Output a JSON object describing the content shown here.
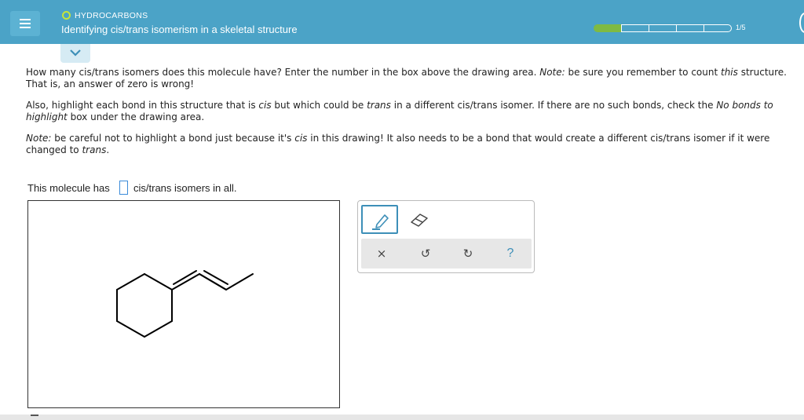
{
  "header": {
    "topic": "HYDROCARBONS",
    "title": "Identifying cis/trans isomerism in a skeletal structure",
    "progress_text": "1/5",
    "progress_fraction": 0.2,
    "accent_color": "#4ba3c7",
    "progress_color": "#7fba42"
  },
  "question": {
    "p1_a": "How many cis/trans isomers does this molecule have? Enter the number in the box above the drawing area. ",
    "p1_note": "Note:",
    "p1_b": " be sure you remember to count ",
    "p1_this": "this",
    "p1_c": " structure. That is, an answer of zero is wrong!",
    "p2_a": "Also, highlight each bond in this structure that is ",
    "p2_cis": "cis",
    "p2_b": " but which could be ",
    "p2_trans": "trans",
    "p2_c": " in a different cis/trans isomer. If there are no such bonds, check the ",
    "p2_nobonds": "No bonds to highlight",
    "p2_d": " box under the drawing area.",
    "p3_note": "Note:",
    "p3_a": " be careful not to highlight a bond just because it's ",
    "p3_cis": "cis",
    "p3_b": " in this drawing! It also needs to be a bond that would create a different cis/trans isomer if it were changed to ",
    "p3_trans": "trans",
    "p3_c": "."
  },
  "answer": {
    "before": "This molecule has",
    "after": "cis/trans isomers in all.",
    "value": ""
  },
  "toolbar": {
    "clear_symbol": "×",
    "undo_symbol": "↺",
    "redo_symbol": "↻",
    "help_symbol": "?",
    "icons": [
      "pencil-icon",
      "eraser-icon",
      "clear-icon",
      "undo-icon",
      "redo-icon",
      "help-icon"
    ]
  }
}
